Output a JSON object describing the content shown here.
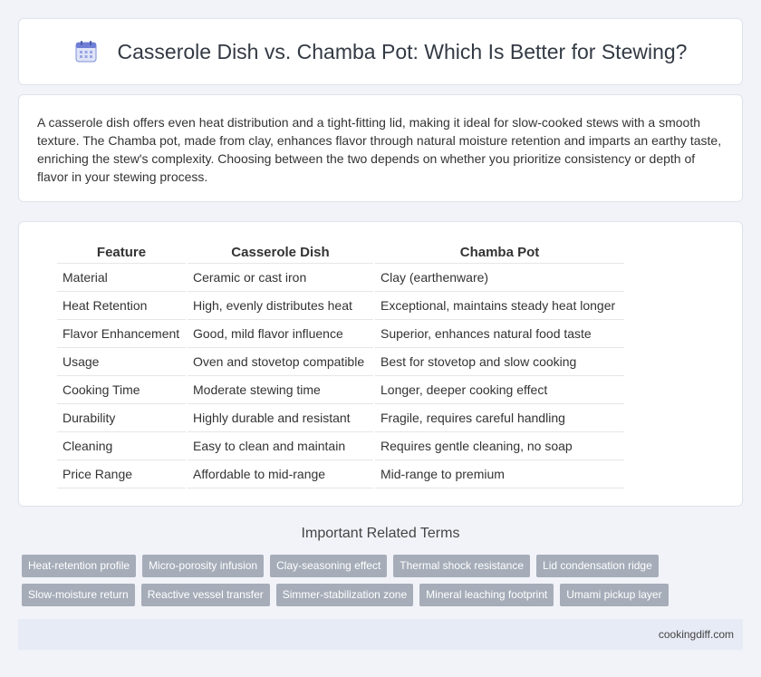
{
  "header": {
    "title": "Casserole Dish vs. Chamba Pot: Which Is Better for Stewing?",
    "icon": "calendar-icon"
  },
  "summary": {
    "text": "A casserole dish offers even heat distribution and a tight-fitting lid, making it ideal for slow-cooked stews with a smooth texture. The Chamba pot, made from clay, enhances flavor through natural moisture retention and imparts an earthy taste, enriching the stew's complexity. Choosing between the two depends on whether you prioritize consistency or depth of flavor in your stewing process."
  },
  "table": {
    "headers": [
      "Feature",
      "Casserole Dish",
      "Chamba Pot"
    ],
    "rows": [
      [
        "Material",
        "Ceramic or cast iron",
        "Clay (earthenware)"
      ],
      [
        "Heat Retention",
        "High, evenly distributes heat",
        "Exceptional, maintains steady heat longer"
      ],
      [
        "Flavor Enhancement",
        "Good, mild flavor influence",
        "Superior, enhances natural food taste"
      ],
      [
        "Usage",
        "Oven and stovetop compatible",
        "Best for stovetop and slow cooking"
      ],
      [
        "Cooking Time",
        "Moderate stewing time",
        "Longer, deeper cooking effect"
      ],
      [
        "Durability",
        "Highly durable and resistant",
        "Fragile, requires careful handling"
      ],
      [
        "Cleaning",
        "Easy to clean and maintain",
        "Requires gentle cleaning, no soap"
      ],
      [
        "Price Range",
        "Affordable to mid-range",
        "Mid-range to premium"
      ]
    ]
  },
  "related": {
    "title": "Important Related Terms",
    "tags_row1": [
      "Heat-retention profile",
      "Micro-porosity infusion",
      "Clay-seasoning effect",
      "Thermal shock resistance",
      "Lid condensation ridge"
    ],
    "tags_row2": [
      "Slow-moisture return",
      "Reactive vessel transfer",
      "Simmer-stabilization zone",
      "Mineral leaching footprint",
      "Umami pickup layer"
    ]
  },
  "footer": {
    "site": "cookingdiff.com"
  },
  "colors": {
    "background": "#f1f3f8",
    "tag": "#a6adb9",
    "footer": "#e7ebf5",
    "icon_accent": "#6f7fd6"
  }
}
